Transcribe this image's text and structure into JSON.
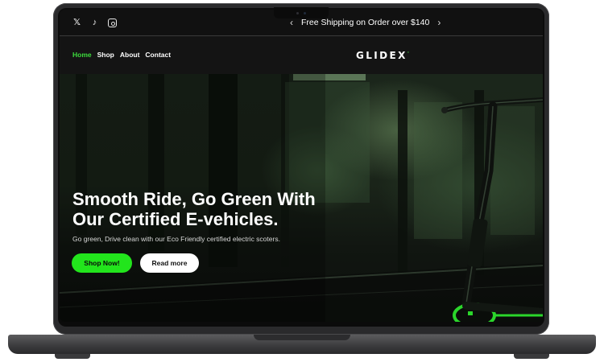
{
  "topbar": {
    "social_icons": [
      "x-icon",
      "tiktok-icon",
      "instagram-icon"
    ],
    "promo_text": "Free Shipping on Order over $140",
    "prev_icon": "chevron-left-icon",
    "next_icon": "chevron-right-icon"
  },
  "nav": {
    "items": [
      {
        "label": "Home",
        "active": true
      },
      {
        "label": "Shop",
        "active": false
      },
      {
        "label": "About",
        "active": false
      },
      {
        "label": "Contact",
        "active": false
      }
    ],
    "logo": "GLIDEX"
  },
  "hero": {
    "title_line1": "Smooth Ride, Go Green With",
    "title_line2": "Our Certified E-vehicles.",
    "subtitle": "Go green, Drive clean with our Eco Friendly certified electric scoters.",
    "primary_button": "Shop Now!",
    "secondary_button": "Read more"
  },
  "colors": {
    "accent": "#22e51c",
    "background": "#141414"
  }
}
